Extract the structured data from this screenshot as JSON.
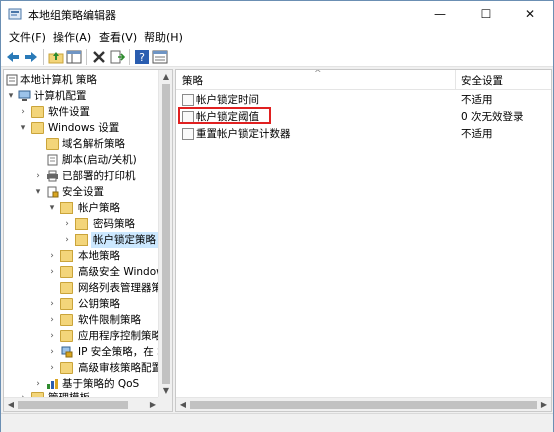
{
  "window": {
    "title": "本地组策略编辑器",
    "controls": {
      "minimize": "—",
      "maximize": "☐",
      "close": "✕"
    }
  },
  "menu": [
    {
      "label": "文件(F)"
    },
    {
      "label": "操作(A)"
    },
    {
      "label": "查看(V)"
    },
    {
      "label": "帮助(H)"
    }
  ],
  "toolbar": {
    "icons": [
      "back-icon",
      "forward-icon",
      "up-folder-icon",
      "show-hide-tree-icon",
      "delete-icon",
      "export-list-icon",
      "help-icon",
      "properties-icon"
    ]
  },
  "tree": {
    "items": [
      {
        "label": "本地计算机 策略",
        "arrow": "",
        "icon": "computer-policy-icon"
      },
      {
        "label": "计算机配置",
        "arrow": "▾",
        "icon": "computer-icon"
      },
      {
        "label": "软件设置",
        "arrow": "›",
        "icon": "folder-icon"
      },
      {
        "label": "Windows 设置",
        "arrow": "▾",
        "icon": "folder-icon"
      },
      {
        "label": "域名解析策略",
        "arrow": "",
        "icon": "folder-icon"
      },
      {
        "label": "脚本(启动/关机)",
        "arrow": "",
        "icon": "script-icon"
      },
      {
        "label": "已部署的打印机",
        "arrow": "›",
        "icon": "printer-icon"
      },
      {
        "label": "安全设置",
        "arrow": "▾",
        "icon": "security-icon"
      },
      {
        "label": "帐户策略",
        "arrow": "▾",
        "icon": "folder-lock-icon"
      },
      {
        "label": "密码策略",
        "arrow": "›",
        "icon": "folder-lock-icon"
      },
      {
        "label": "帐户锁定策略",
        "arrow": "›",
        "icon": "folder-lock-icon"
      },
      {
        "label": "本地策略",
        "arrow": "›",
        "icon": "folder-lock-icon"
      },
      {
        "label": "高级安全 Window",
        "arrow": "›",
        "icon": "folder-icon"
      },
      {
        "label": "网络列表管理器策略",
        "arrow": "",
        "icon": "folder-icon"
      },
      {
        "label": "公钥策略",
        "arrow": "›",
        "icon": "folder-icon"
      },
      {
        "label": "软件限制策略",
        "arrow": "›",
        "icon": "folder-icon"
      },
      {
        "label": "应用程序控制策略",
        "arrow": "›",
        "icon": "folder-icon"
      },
      {
        "label": "IP 安全策略，在 本",
        "arrow": "›",
        "icon": "ip-security-icon"
      },
      {
        "label": "高级审核策略配置",
        "arrow": "›",
        "icon": "folder-icon"
      },
      {
        "label": "基于策略的 QoS",
        "arrow": "›",
        "icon": "qos-chart-icon"
      },
      {
        "label": "管理模板",
        "arrow": "›",
        "icon": "folder-icon"
      }
    ],
    "selected_index": 10
  },
  "list": {
    "columns": [
      "策略",
      "安全设置"
    ],
    "rows": [
      {
        "name": "帐户锁定时间",
        "value": "不适用"
      },
      {
        "name": "帐户锁定阈值",
        "value": "0 次无效登录"
      },
      {
        "name": "重置帐户锁定计数器",
        "value": "不适用"
      }
    ],
    "highlighted_row_index": 1
  },
  "colors": {
    "selection": "#cce8ff",
    "highlight_border": "#e02020",
    "folder": "#f3d57a"
  }
}
